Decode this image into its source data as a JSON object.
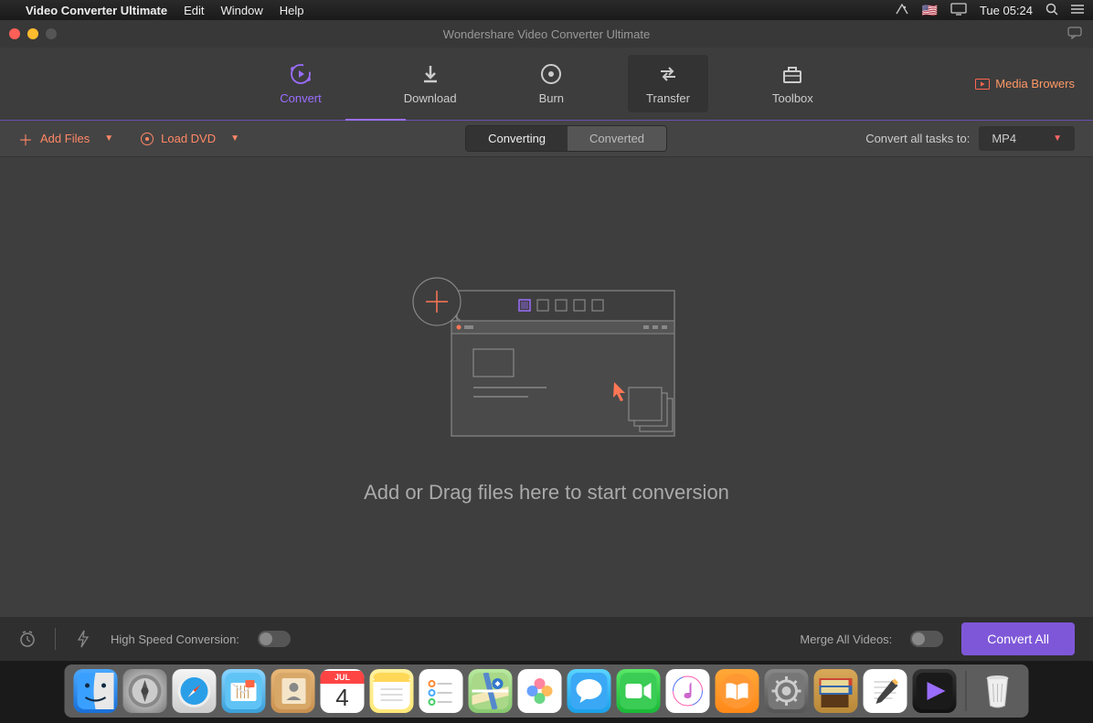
{
  "menubar": {
    "app_name": "Video Converter Ultimate",
    "items": [
      "Edit",
      "Window",
      "Help"
    ],
    "time": "Tue 05:24"
  },
  "window": {
    "title": "Wondershare Video Converter Ultimate",
    "traffic_colors": {
      "close": "#ff5f57",
      "min": "#febc2e",
      "max": "#555"
    }
  },
  "maintabs": {
    "items": [
      {
        "key": "convert",
        "label": "Convert",
        "active": true
      },
      {
        "key": "download",
        "label": "Download",
        "active": false
      },
      {
        "key": "burn",
        "label": "Burn",
        "active": false
      },
      {
        "key": "transfer",
        "label": "Transfer",
        "active": false,
        "hover": true
      },
      {
        "key": "toolbox",
        "label": "Toolbox",
        "active": false
      }
    ],
    "media_browsers": "Media Browers"
  },
  "toolbar": {
    "add_files": "Add Files",
    "load_dvd": "Load DVD",
    "segments": {
      "converting": "Converting",
      "converted": "Converted",
      "active": "converting"
    },
    "convert_all_label": "Convert all tasks to:",
    "format": "MP4"
  },
  "center": {
    "prompt": "Add or Drag files here to start conversion"
  },
  "bottombar": {
    "hs_label": "High Speed Conversion:",
    "merge_label": "Merge All Videos:",
    "convert_all_btn": "Convert All"
  },
  "dock": {
    "calendar": {
      "month": "JUL",
      "day": "4"
    }
  },
  "colors": {
    "accent": "#9b6dff",
    "accent2": "#ff8866",
    "button": "#7e57d8"
  }
}
